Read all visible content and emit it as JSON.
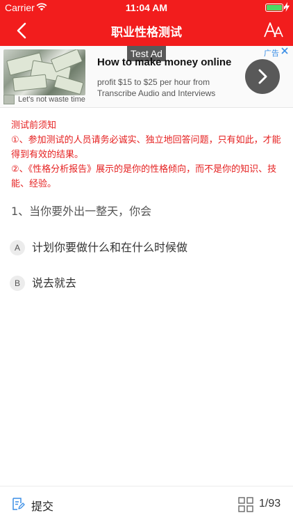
{
  "status_bar": {
    "carrier": "Carrier",
    "time": "11:04 AM",
    "battery_color": "#4cd964"
  },
  "nav": {
    "title": "职业性格测试",
    "back_icon": "chevron-left-icon",
    "font_size_icon": "font-size-icon",
    "background_color": "#f21d1d"
  },
  "ad": {
    "tag": "Test Ad",
    "headline": "How to make money online",
    "description": "profit $15 to $25 per hour from Transcribe Audio and Interviews",
    "tagline": "Let's not waste time",
    "badge": "广告",
    "close_icon": "close-icon",
    "arrow_icon": "chevron-right-icon"
  },
  "notice": {
    "title": "测试前须知",
    "items": [
      "①、参加测试的人员请务必诚实、独立地回答问题，只有如此，才能得到有效的结果。",
      "②、《性格分析报告》展示的是你的性格倾向，而不是你的知识、技能、经验。"
    ],
    "color": "#e52020"
  },
  "question": {
    "text": "1、当你要外出一整天，你会",
    "options": [
      {
        "letter": "A",
        "text": "计划你要做什么和在什么时候做"
      },
      {
        "letter": "B",
        "text": "说去就去"
      }
    ]
  },
  "bottom_bar": {
    "submit_label": "提交",
    "page_count": "1/93",
    "submit_icon": "note-icon",
    "grid_icon": "grid-icon"
  }
}
